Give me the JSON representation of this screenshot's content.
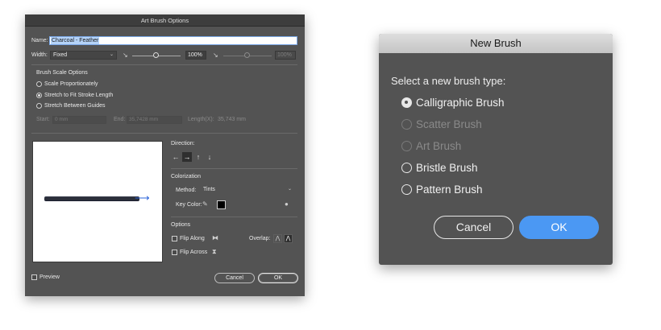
{
  "art_brush_options": {
    "title": "Art Brush Options",
    "name_label": "Name:",
    "name_value": "Charcoal - Feather",
    "width_label": "Width:",
    "width_value": "Fixed",
    "width_percent": "100%",
    "width_percent_right": "100%",
    "brush_scale_header": "Brush Scale Options",
    "scale_options": [
      {
        "label": "Scale Proportionately",
        "selected": false
      },
      {
        "label": "Stretch to Fit Stroke Length",
        "selected": true
      },
      {
        "label": "Stretch Between Guides",
        "selected": false
      }
    ],
    "start_label": "Start:",
    "start_value": "0 mm",
    "end_label": "End:",
    "end_value": "35,7428 mm",
    "length_label": "Length(X):",
    "length_value": "35,743 mm",
    "direction_label": "Direction:",
    "direction_buttons": [
      "←",
      "→",
      "↑",
      "↓"
    ],
    "colorization_label": "Colorization",
    "method_label": "Method:",
    "method_value": "Tints",
    "key_color_label": "Key Color:",
    "key_color": "#000000",
    "options_label": "Options",
    "flip_along_label": "Flip Along",
    "flip_across_label": "Flip Across",
    "overlap_label": "Overlap:",
    "preview_label": "Preview",
    "cancel_label": "Cancel",
    "ok_label": "OK"
  },
  "new_brush": {
    "title": "New Brush",
    "prompt": "Select a new brush type:",
    "options": [
      {
        "label": "Calligraphic Brush",
        "selected": true,
        "enabled": true
      },
      {
        "label": "Scatter Brush",
        "selected": false,
        "enabled": false
      },
      {
        "label": "Art Brush",
        "selected": false,
        "enabled": false
      },
      {
        "label": "Bristle Brush",
        "selected": false,
        "enabled": true
      },
      {
        "label": "Pattern Brush",
        "selected": false,
        "enabled": true
      }
    ],
    "cancel_label": "Cancel",
    "ok_label": "OK",
    "ok_color": "#4b98f3"
  }
}
